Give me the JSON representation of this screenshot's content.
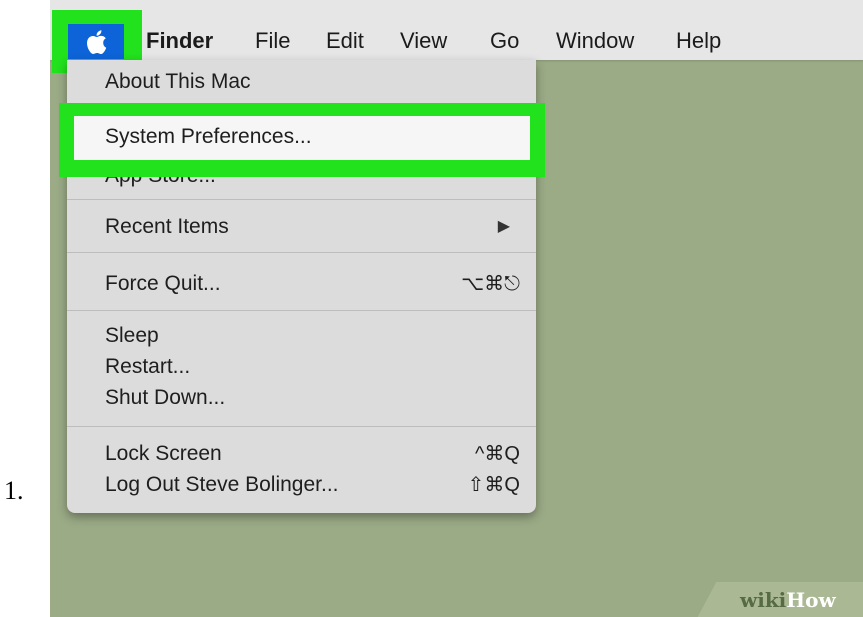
{
  "step_number": "1.",
  "menubar": {
    "apple_icon": "apple-logo-icon",
    "items": [
      "Finder",
      "File",
      "Edit",
      "View",
      "Go",
      "Window",
      "Help"
    ]
  },
  "apple_menu": {
    "about": "About This Mac",
    "system_preferences": "System Preferences...",
    "app_store_partial": "App Store...",
    "recent_items": "Recent Items",
    "recent_items_arrow": "▶",
    "force_quit": "Force Quit...",
    "force_quit_shortcut": "⌥⌘⎋",
    "sleep": "Sleep",
    "restart": "Restart...",
    "shut_down": "Shut Down...",
    "lock_screen": "Lock Screen",
    "lock_screen_shortcut": "^⌘Q",
    "log_out": "Log Out Steve Bolinger...",
    "log_out_shortcut": "⇧⌘Q"
  },
  "watermark": {
    "wiki": "wiki",
    "how": "How"
  },
  "colors": {
    "highlight": "#22e11d",
    "apple_button": "#0d64d8",
    "desktop": "#9bab86",
    "menu_bg": "#dcdcdc"
  }
}
